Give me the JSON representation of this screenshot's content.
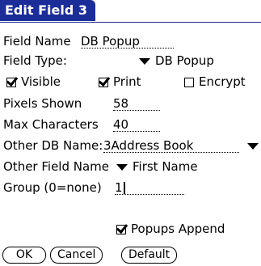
{
  "title": "Edit Field 3",
  "field_name": {
    "label": "Field Name",
    "value": "DB Popup"
  },
  "field_type": {
    "label": "Field Type:",
    "value": "DB Popup"
  },
  "checkboxes": [
    {
      "label": "Visible",
      "checked": true
    },
    {
      "label": "Print",
      "checked": true
    },
    {
      "label": "Encrypt",
      "checked": false
    }
  ],
  "pixels_shown": {
    "label": "Pixels Shown",
    "value": "58"
  },
  "max_characters": {
    "label": "Max Characters",
    "value": "40"
  },
  "other_db_name": {
    "label": "Other DB Name:",
    "value": "3Address Book"
  },
  "other_field_name": {
    "label": "Other Field Name",
    "value": "First Name"
  },
  "group": {
    "label": "Group (0=none)",
    "value": "1"
  },
  "popups_append": {
    "label": "Popups Append",
    "checked": true
  },
  "buttons": {
    "ok": "OK",
    "cancel": "Cancel",
    "default": "Default"
  },
  "colors": {
    "title_bg": "#1c2d9a"
  }
}
